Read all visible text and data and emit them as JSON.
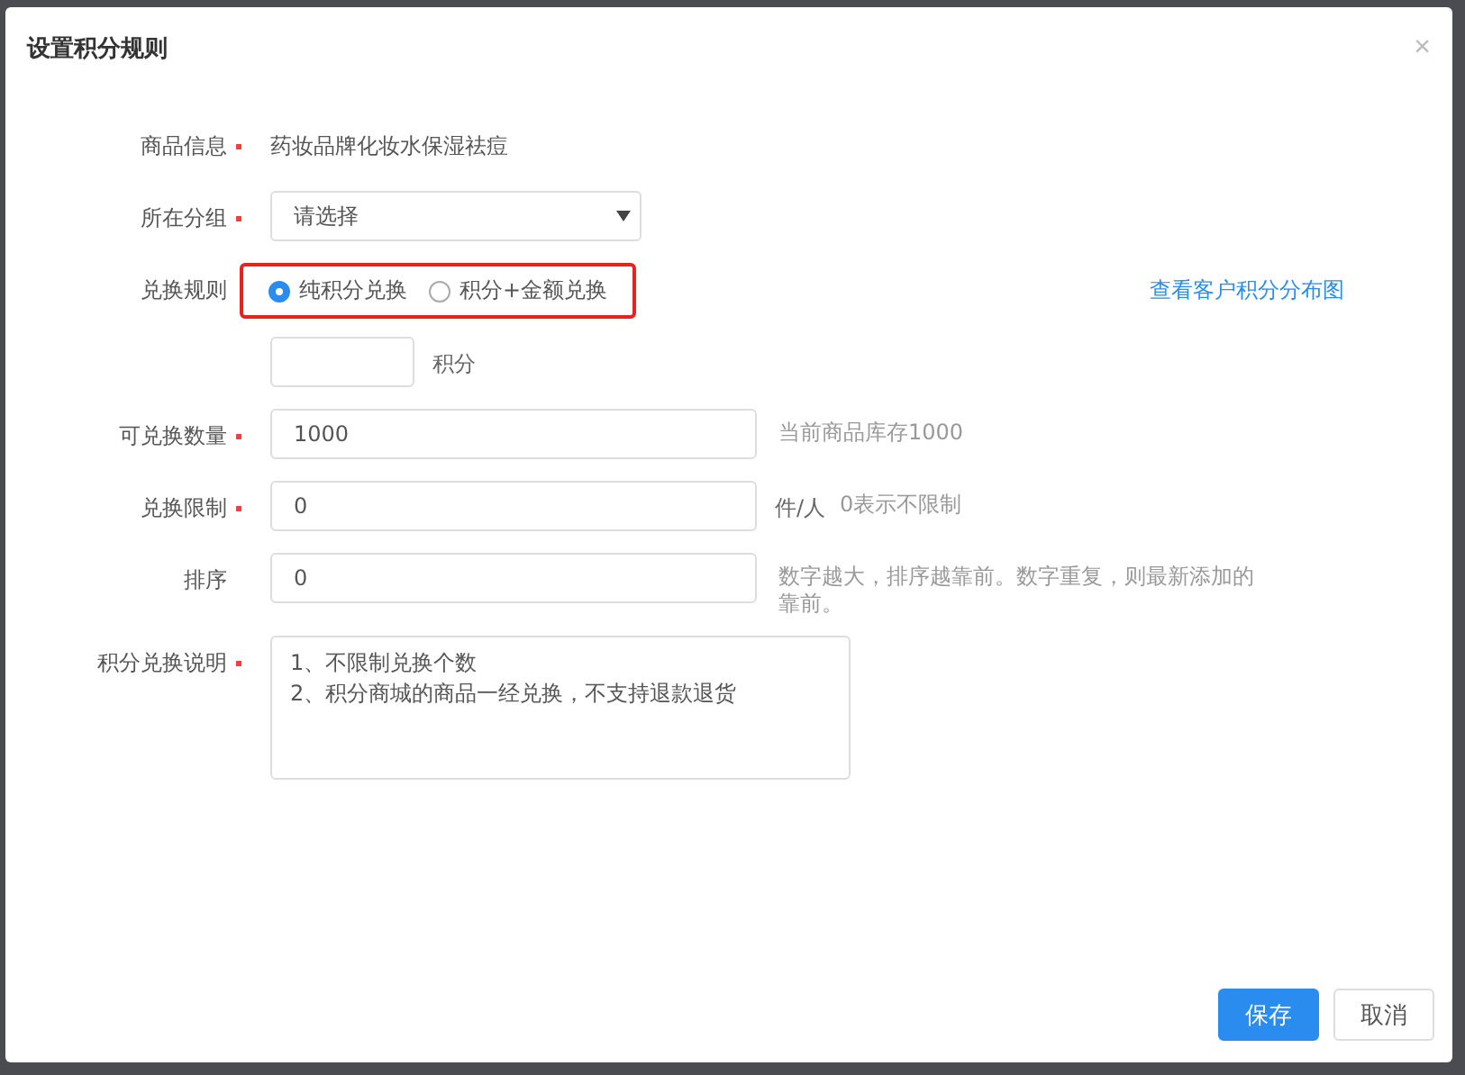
{
  "dialog": {
    "title": "设置积分规则",
    "close": "×"
  },
  "fields": [
    {
      "kind": "text",
      "label": "商品信息",
      "required": true,
      "value": "药妆品牌化妆水保湿祛痘"
    },
    {
      "kind": "select",
      "label": "所在分组",
      "required": true,
      "value": "请选择"
    },
    {
      "kind": "radio",
      "label": "兑换规则",
      "required": false,
      "highlighted": true,
      "options": [
        {
          "label": "纯积分兑换",
          "selected": true
        },
        {
          "label": "积分+金额兑换",
          "selected": false
        }
      ],
      "link": "查看客户积分分布图"
    },
    {
      "kind": "points",
      "unit": "积分"
    },
    {
      "kind": "input",
      "label": "可兑换数量",
      "required": true,
      "value": "1000",
      "hint": "当前商品库存1000"
    },
    {
      "kind": "input",
      "label": "兑换限制",
      "required": true,
      "value": "0",
      "unit": "件/人",
      "hint": "0表示不限制"
    },
    {
      "kind": "input",
      "label": "排序",
      "required": false,
      "value": "0",
      "hint": "数字越大，排序越靠前。数字重复，则最新添加的靠前。"
    },
    {
      "kind": "textarea",
      "label": "积分兑换说明",
      "required": true,
      "lines": [
        "1、不限制兑换个数",
        "2、积分商城的商品一经兑换，不支持退款退货"
      ]
    }
  ],
  "buttons": [
    {
      "label": "保存",
      "kind": "primary"
    },
    {
      "label": "取消",
      "kind": "default"
    }
  ]
}
